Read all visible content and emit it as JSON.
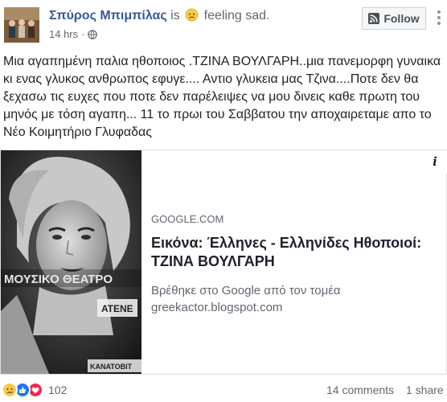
{
  "post": {
    "author": "Σπύρος Μπιμπίλας",
    "feeling_prefix": "is",
    "feeling": "feeling sad.",
    "timestamp": "14 hrs",
    "privacy_icon": "globe-icon",
    "follow_label": "Follow",
    "text": "Μια αγαπημένη παλια ηθοποιος .ΤΖΙΝΑ ΒΟΥΛΓΑΡΗ..μια πανεμορφη γυναικα κι ενας γλυκος ανθρωπος εφυγε.... Αντιο γλυκεια μας Τζινα....Ποτε δεν θα ξεχασω τις ευχες που ποτε δεν παρέλειψες να μου δινεις καθε πρωτη του μηνός με τόση αγαπη... 11 το πρωι του Σαββατου την αποχαιρεταμε απο το Νέο Κοιμητήριο Γλυφαδας"
  },
  "link_card": {
    "domain": "GOOGLE.COM",
    "title": "Εικόνα: Έλληνες - Ελληνίδες Ηθοποιοί: ΤΖΙΝΑ ΒΟΥΛΓΑΡΗ",
    "description": "Βρέθηκε στο Google από τον τομέα greekactor.blogspot.com",
    "info_glyph": "i",
    "image_text": {
      "banner": "ΜΟΥΣΙΚΟ ΘΕΑΤΡΟ",
      "sign_top": "ΑΤΕΝΕ",
      "sign_bottom": "ΚΑΝΑΤΟΒΙΤ"
    }
  },
  "footer": {
    "reaction_icons": [
      "sad-reaction-icon",
      "like-reaction-icon",
      "love-reaction-icon"
    ],
    "reaction_count": "102",
    "comments": "14 comments",
    "shares": "1 share"
  },
  "colors": {
    "link_blue": "#365899",
    "secondary_text": "#616770",
    "like_blue": "#1877f2",
    "love_red": "#f0284a",
    "sad_yellow": "#f7c948"
  }
}
